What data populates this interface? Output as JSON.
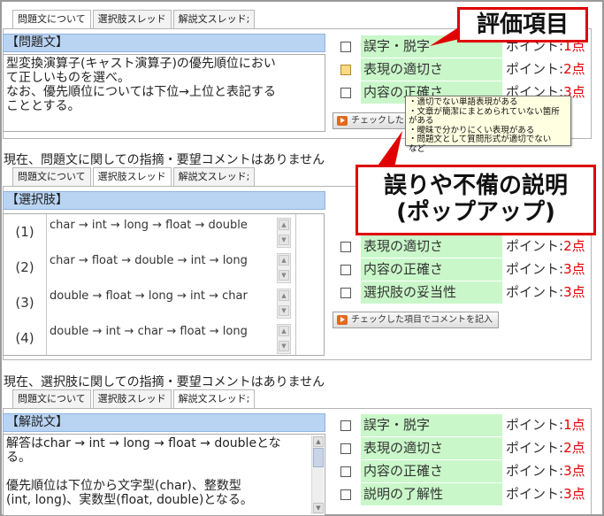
{
  "tabs": [
    "問題文について",
    "選択肢スレッド",
    "解説文スレッド;"
  ],
  "question": {
    "header": "【問題文】",
    "lines": [
      "型変換演算子(キャスト演算子)の優先順位におい",
      "て正しいものを選べ。",
      "なお、優先順位については下位→上位と表記する",
      "こととする。"
    ],
    "criteria": [
      {
        "label": "誤字・脱字",
        "points_prefix": "ポイント:",
        "points": "1点"
      },
      {
        "label": "表現の適切さ",
        "points_prefix": "ポイント:",
        "points": "2点"
      },
      {
        "label": "内容の正確さ",
        "points_prefix": "ポイント:",
        "points": "3点"
      }
    ],
    "button": "チェックした項目でコメントを記入",
    "button_partial": "チェックした",
    "status": "現在、問題文に関しての指摘・要望コメントはありません"
  },
  "tooltip_lines": [
    "・適切でない単語表現がある",
    "・文章が簡潔にまとめられていない箇所がある",
    "・曖昧で分かりにくい表現がある",
    "・問題文として質問形式が適切でない",
    "など"
  ],
  "choices": {
    "header": "【選択肢】",
    "items": [
      {
        "index": "(1)",
        "text": "char → int → long → float → double"
      },
      {
        "index": "(2)",
        "text": "char → float → double → int → long"
      },
      {
        "index": "(3)",
        "text": "double → float → long → int → char"
      },
      {
        "index": "(4)",
        "text": "double → int → char → float → long"
      }
    ],
    "criteria": [
      {
        "label": "表現の適切さ",
        "points_prefix": "ポイント:",
        "points": "2点"
      },
      {
        "label": "内容の正確さ",
        "points_prefix": "ポイント:",
        "points": "3点"
      },
      {
        "label": "選択肢の妥当性",
        "points_prefix": "ポイント:",
        "points": "3点"
      }
    ],
    "button": "チェックした項目でコメントを記入",
    "status": "現在、選択肢に関しての指摘・要望コメントはありません"
  },
  "explanation": {
    "header": "【解説文】",
    "lines": [
      "解答はchar → int → long → float → doubleとな",
      "る。",
      "",
      "優先順位は下位から文字型(char)、整数型",
      "(int, long)、実数型(float, double)となる。"
    ],
    "criteria": [
      {
        "label": "誤字・脱字",
        "points_prefix": "ポイント:",
        "points": "1点"
      },
      {
        "label": "表現の適切さ",
        "points_prefix": "ポイント:",
        "points": "2点"
      },
      {
        "label": "内容の正確さ",
        "points_prefix": "ポイント:",
        "points": "3点"
      },
      {
        "label": "説明の了解性",
        "points_prefix": "ポイント:",
        "points": "3点"
      }
    ]
  },
  "callouts": {
    "evaluation": "評価項目",
    "popup_line1": "誤りや不備の説明",
    "popup_line2": "(ポップアップ)"
  },
  "colors": {
    "header_bg": "#b9d4f3",
    "criteria_bg": "#c9f7c9",
    "points_red": "#e00000",
    "callout_border": "#e00000",
    "tooltip_bg": "#ffffe1"
  }
}
